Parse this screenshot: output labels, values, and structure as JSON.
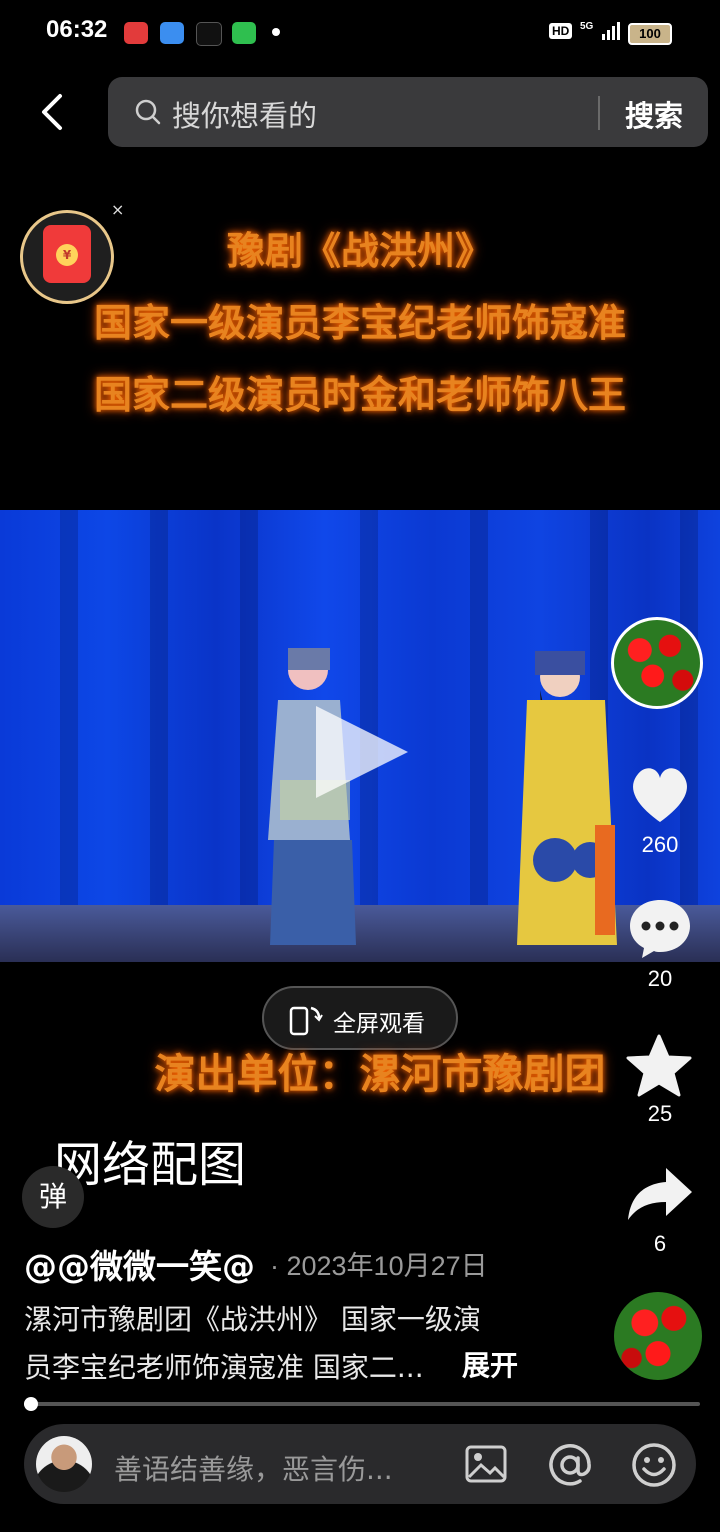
{
  "status_bar": {
    "time": "06:32",
    "hd": "HD",
    "network": "5G",
    "battery": "100"
  },
  "header": {
    "search_placeholder": "搜你想看的",
    "search_button": "搜索"
  },
  "video_title": {
    "line1": "豫剧《战洪州》",
    "line2": "国家一级演员李宝纪老师饰寇准",
    "line3": "国家二级演员时金和老师饰八王"
  },
  "video": {
    "fullscreen_label": "全屏观看",
    "troupe_caption": "演出单位：漯河市豫剧团",
    "overlay_text": "网络配图",
    "progress": 0.01
  },
  "rail": {
    "likes": "260",
    "comments": "20",
    "favorites": "25",
    "shares": "6"
  },
  "post": {
    "author": "@@微微一笑@",
    "date": "· 2023年10月27日",
    "desc_line1": "漯河市豫剧团《战洪州》 国家一级演",
    "desc_line2": "员李宝纪老师饰演寇准 国家二...",
    "expand": "展开"
  },
  "danmu_label": "弹",
  "comment_input": {
    "placeholder": "善语结善缘，恶言伤..."
  },
  "icons": [
    "back-icon",
    "search-icon",
    "red-packet-icon",
    "play-icon",
    "heart-icon",
    "comment-icon",
    "star-icon",
    "share-icon",
    "fullscreen-icon",
    "image-icon",
    "at-icon",
    "emoji-icon"
  ]
}
